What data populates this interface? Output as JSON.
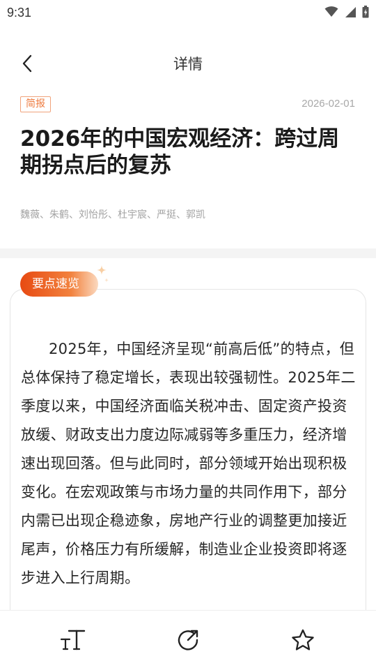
{
  "status_bar": {
    "time": "9:31"
  },
  "header": {
    "title": "详情"
  },
  "article": {
    "tag": "简报",
    "date": "2026-02-01",
    "title": "2026年的中国宏观经济：跨过周期拐点后的复苏",
    "authors": "魏薇、朱鹤、刘怡彤、杜宇宸、严挺、郭凯"
  },
  "summary": {
    "badge": "要点速览",
    "text": "2025年，中国经济呈现“前高后低”的特点，但总体保持了稳定增长，表现出较强韧性。2025年二季度以来，中国经济面临关税冲击、固定资产投资放缓、财政支出力度边际减弱等多重压力，经济增速出现回落。但与此同时，部分领域开始出现积极变化。在宏观政策与市场力量的共同作用下，部分内需已出现企稳迹象，房地产行业的调整更加接近尾声，价格压力有所缓解，制造业企业投资即将逐步进入上行周期。"
  },
  "colors": {
    "accent": "#ee7b3f",
    "badge_start": "#e74a12",
    "badge_end": "#fbd9bf"
  },
  "icons": {
    "back": "chevron-left-icon",
    "font_size": "text-size-icon",
    "share": "share-icon",
    "favorite": "star-icon"
  }
}
